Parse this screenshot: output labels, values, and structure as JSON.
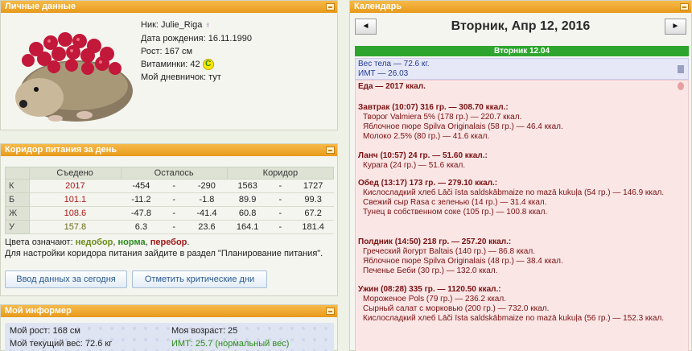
{
  "personal": {
    "header": "Личные данные",
    "nick_label": "Ник:",
    "nick": "Julie_Riga",
    "birth_label": "Дата рождения:",
    "birth": "16.11.1990",
    "height_label": "Рост:",
    "height": "167 см",
    "vit_label": "Витаминки:",
    "vit": "42",
    "vit_badge": "C",
    "diary_label": "Мой дневничок:",
    "diary": "тут"
  },
  "corridor": {
    "header": "Коридор питания за день",
    "cols": [
      "Съедено",
      "Осталось",
      "Коридор"
    ],
    "rows": [
      {
        "k": "К",
        "eaten": "2017",
        "r1": "-454",
        "r2": "-290",
        "c1": "1563",
        "c2": "1727"
      },
      {
        "k": "Б",
        "eaten": "101.1",
        "r1": "-11.2",
        "r2": "-1.8",
        "c1": "89.9",
        "c2": "99.3"
      },
      {
        "k": "Ж",
        "eaten": "108.6",
        "r1": "-47.8",
        "r2": "-41.4",
        "c1": "60.8",
        "c2": "67.2"
      },
      {
        "k": "У",
        "eaten": "157.8",
        "r1": "6.3",
        "r2": "23.6",
        "c1": "164.1",
        "c2": "181.4"
      }
    ],
    "dash": "-",
    "legend_prefix": "Цвета означают:",
    "legend_low": "недобор",
    "legend_norm": "норма",
    "legend_over": "перебор",
    "note": "Для настройки коридора питания зайдите в раздел \"Планирование питания\".",
    "btn_today": "Ввод данных за сегодня",
    "btn_critical": "Отметить критические дни"
  },
  "informer": {
    "header": "Мой информер",
    "height": "Мой рост: 168 см",
    "age": "Моя возраст: 25",
    "weight": "Мой текущий вес: 72.6 кг",
    "bmi": "ИМТ: 25.7 (нормальный вес)"
  },
  "calendar": {
    "header": "Календарь",
    "prev": "◄",
    "next": "►",
    "date": "Вторник, Апр 12, 2016",
    "daybar": "Вторник 12.04",
    "weight": "Вес тела — 72.6 кг.",
    "bmi": "ИМТ — 26.03",
    "food_total": "Еда — 2017 ккал.",
    "meals": [
      {
        "title": "Завтрак (10:07) 316 гр. — 308.70 ккал.:",
        "items": [
          "Творог Valmiera 5% (178 гр.) — 220.7 ккал.",
          "Яблочное пюре Spilva Originalais (58 гр.) — 46.4 ккал.",
          "Молоко 2.5% (80 гр.) — 41.6 ккал."
        ]
      },
      {
        "title": "Ланч (10:57) 24 гр. — 51.60 ккал.:",
        "items": [
          "Курага (24 гр.) — 51.6 ккал."
        ]
      },
      {
        "title": "Обед (13:17) 173 гр. — 279.10 ккал.:",
        "items": [
          "Кисло­сладкий хлеб Lāči īsta saldskābmaize no mazā kukuļa (54 гр.) — 146.9 ккал.",
          "Свежий сыр Rasa с зеленью (14 гр.) — 31.4 ккал.",
          "Тунец в собственном соке (105 гр.) — 100.8 ккал."
        ]
      },
      {
        "title": "Полдник (14:50) 218 гр. — 257.20 ккал.:",
        "items": [
          "Греческий йогурт Baltais (140 гр.) — 86.8 ккал.",
          "Яблочное пюре Spilva Originalais (48 гр.) — 38.4 ккал.",
          "Печенье Беби (30 гр.) — 132.0 ккал."
        ]
      },
      {
        "title": "Ужин (08:28) 335 гр. — 1120.50 ккал.:",
        "items": [
          "Мороженое Pols (79 гр.) — 236.2 ккал.",
          "Сырный салат с морковью (200 гр.) — 732.0 ккал.",
          "Кисло­сладкий хлеб Lāči īsta saldskābmaize no mazā kukuļa (56 гр.) — 152.3 ккал."
        ]
      }
    ]
  }
}
